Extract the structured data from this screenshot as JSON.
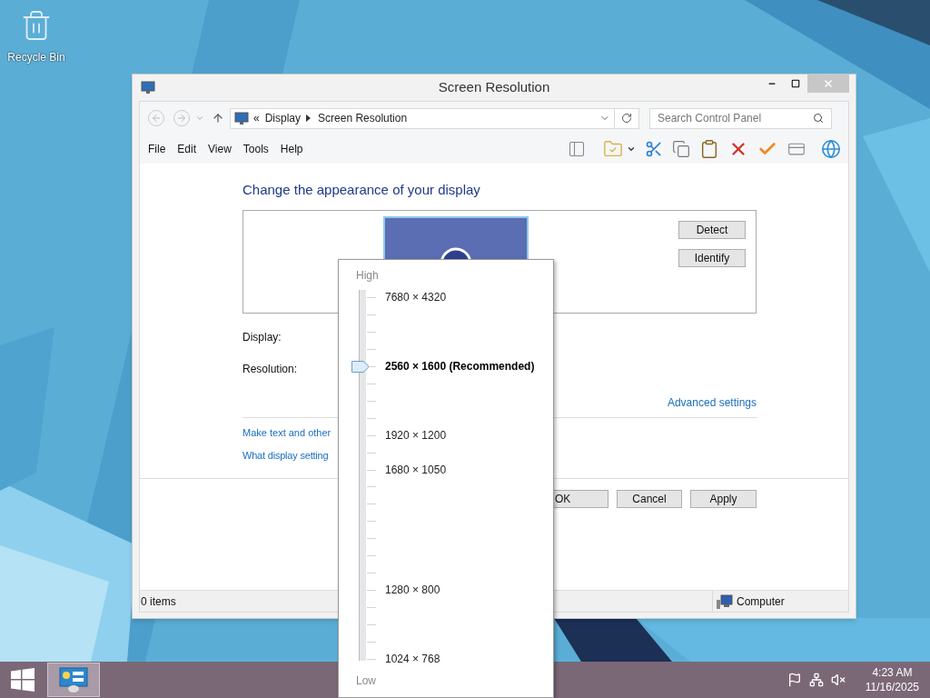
{
  "desktop": {
    "icons": [
      {
        "label": "Recycle Bin"
      }
    ]
  },
  "window": {
    "title": "Screen Resolution",
    "address": {
      "prefix": "«",
      "crumbs": [
        "Display",
        "Screen Resolution"
      ]
    },
    "search": {
      "placeholder": "Search Control Panel"
    },
    "menu": [
      "File",
      "Edit",
      "View",
      "Tools",
      "Help"
    ],
    "heading": "Change the appearance of your display",
    "side_buttons": [
      "Detect",
      "Identify"
    ],
    "fields": [
      {
        "label": "Display:"
      },
      {
        "label": "Resolution:"
      }
    ],
    "advanced_link": "Advanced settings",
    "links": [
      "Make text and other",
      "What display setting"
    ],
    "dialog_buttons": [
      "OK",
      "Cancel",
      "Apply"
    ],
    "status_bar": {
      "count": "0 items",
      "location": "Computer"
    }
  },
  "resolution_popup": {
    "high_label": "High",
    "low_label": "Low",
    "level": 0.81,
    "options": [
      {
        "label": "7680 × 4320",
        "selected": false
      },
      {
        "label": "2560 × 1600 (Recommended)",
        "selected": true
      },
      {
        "label": "1920 × 1200",
        "selected": false
      },
      {
        "label": "1680 × 1050",
        "selected": false
      },
      {
        "label": "1280 × 800",
        "selected": false
      },
      {
        "label": "1024 × 768",
        "selected": false
      }
    ]
  },
  "taskbar": {
    "clock": {
      "time": "4:23 AM",
      "date": "11/16/2025"
    }
  }
}
